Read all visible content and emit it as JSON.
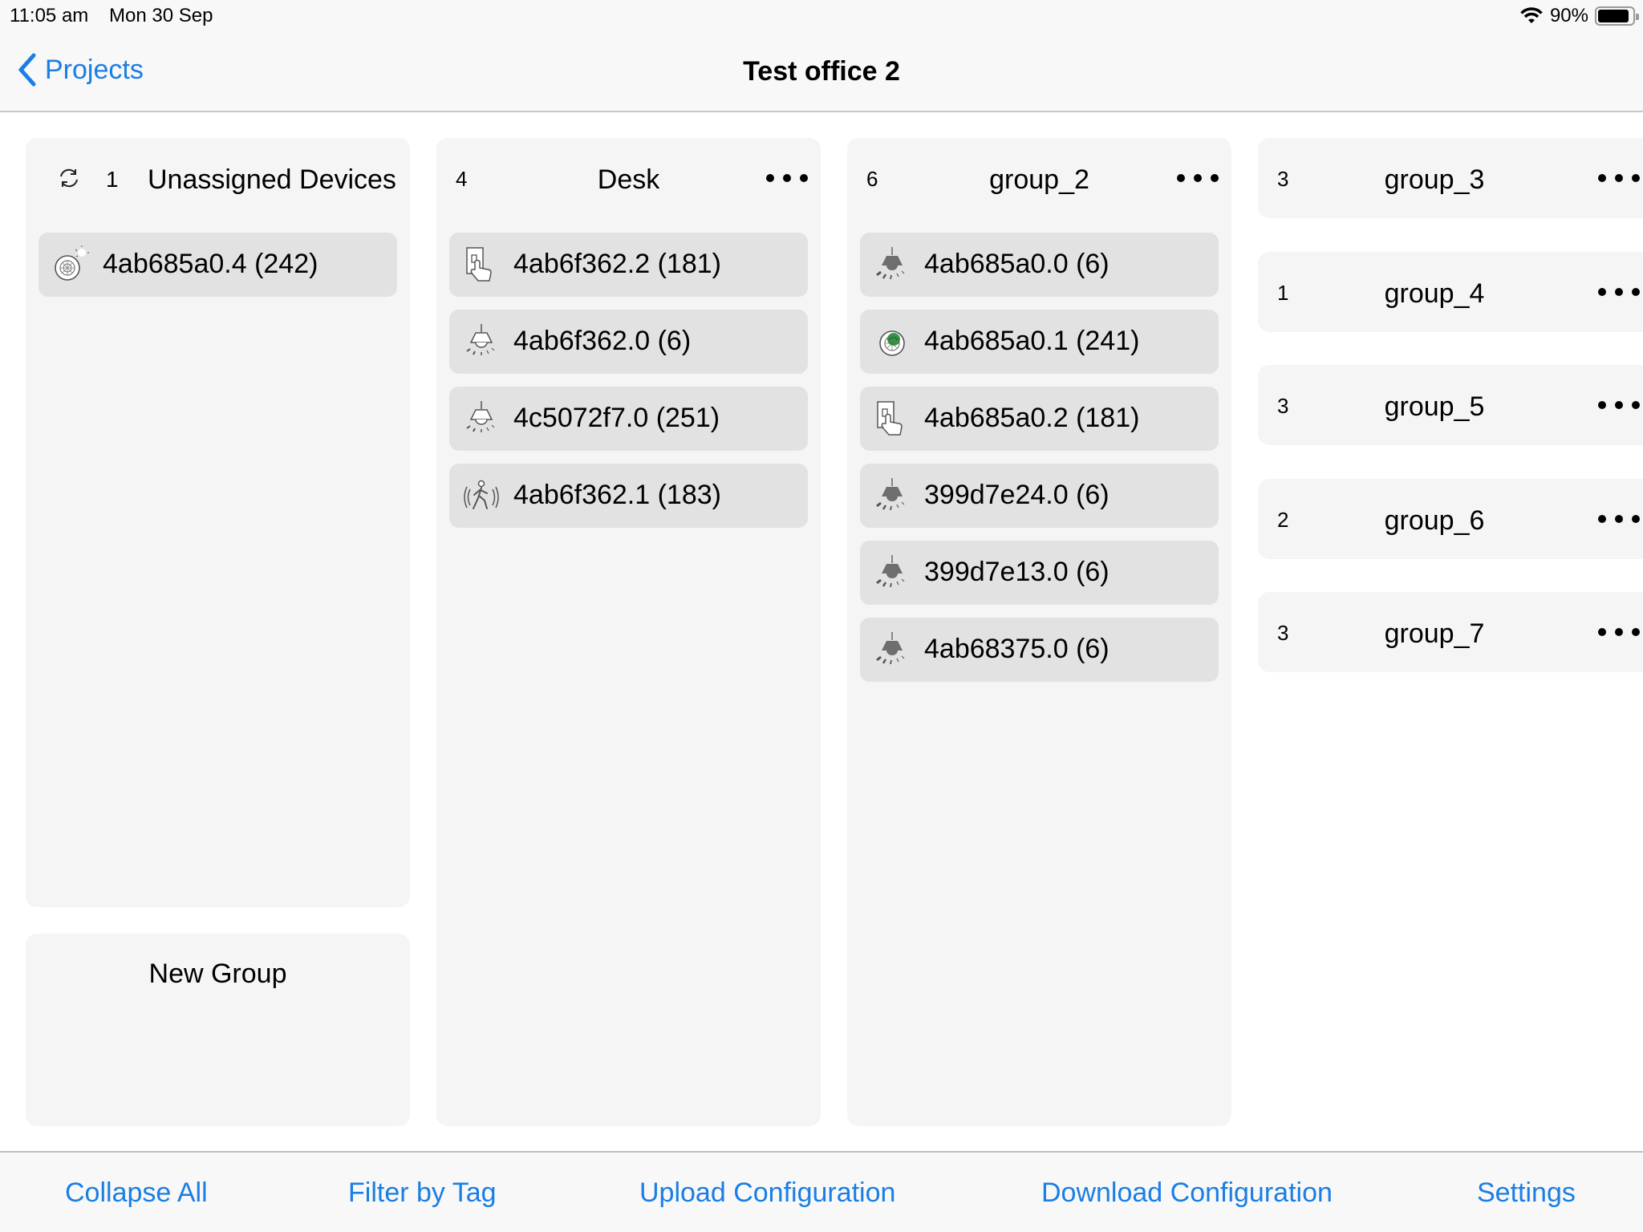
{
  "status_bar": {
    "time": "11:05 am",
    "date": "Mon 30 Sep",
    "battery_percent_label": "90%",
    "battery_level": 0.9
  },
  "nav": {
    "back_label": "Projects",
    "title": "Test office 2"
  },
  "unassigned": {
    "count": "1",
    "title": "Unassigned Devices",
    "devices": [
      {
        "label": "4ab685a0.4 (242)",
        "icon": "sensor-daylight-icon"
      }
    ]
  },
  "new_group": {
    "label": "New Group"
  },
  "groups": [
    {
      "count": "4",
      "title": "Desk",
      "devices": [
        {
          "label": "4ab6f362.2 (181)",
          "icon": "switch-icon"
        },
        {
          "label": "4ab6f362.0 (6)",
          "icon": "pendant-light-outline-icon"
        },
        {
          "label": "4c5072f7.0 (251)",
          "icon": "pendant-light-outline-icon"
        },
        {
          "label": "4ab6f362.1 (183)",
          "icon": "motion-sensor-icon"
        }
      ]
    },
    {
      "count": "6",
      "title": "group_2",
      "devices": [
        {
          "label": "4ab685a0.0 (6)",
          "icon": "pendant-light-filled-icon"
        },
        {
          "label": "4ab685a0.1 (241)",
          "icon": "sensor-active-icon"
        },
        {
          "label": "4ab685a0.2 (181)",
          "icon": "switch-icon"
        },
        {
          "label": "399d7e24.0 (6)",
          "icon": "pendant-light-filled-icon"
        },
        {
          "label": "399d7e13.0 (6)",
          "icon": "pendant-light-filled-icon"
        },
        {
          "label": "4ab68375.0 (6)",
          "icon": "pendant-light-filled-icon"
        }
      ]
    }
  ],
  "collapsed_groups": [
    {
      "count": "3",
      "title": "group_3"
    },
    {
      "count": "1",
      "title": "group_4"
    },
    {
      "count": "3",
      "title": "group_5"
    },
    {
      "count": "2",
      "title": "group_6"
    },
    {
      "count": "3",
      "title": "group_7"
    }
  ],
  "toolbar": {
    "collapse_all": "Collapse All",
    "filter_by_tag": "Filter by Tag",
    "upload_configuration": "Upload Configuration",
    "download_configuration": "Download Configuration",
    "settings": "Settings"
  },
  "colors": {
    "accent": "#1a7ee5",
    "column_bg": "#f5f5f5",
    "device_bg": "#e2e2e2",
    "sensor_active": "#2a8a3a"
  }
}
